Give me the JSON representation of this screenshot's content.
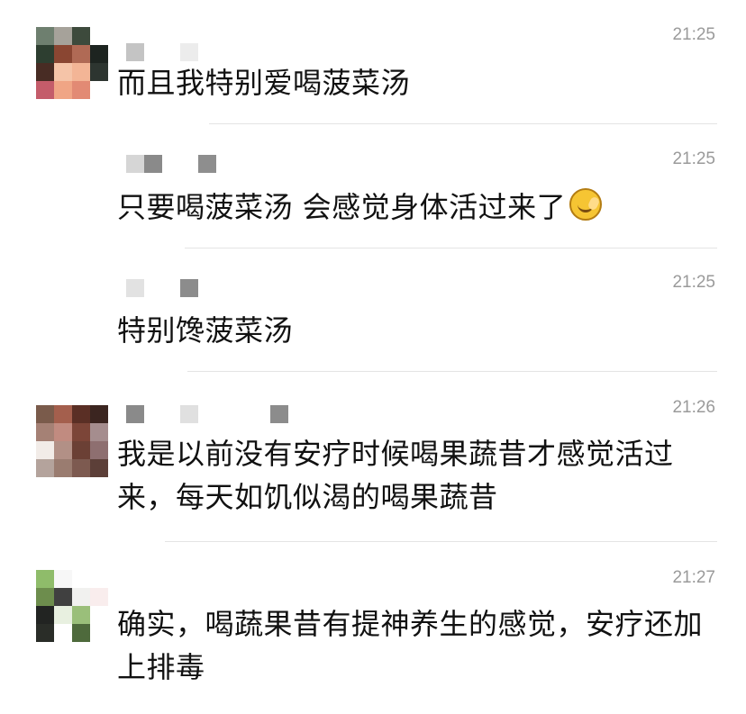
{
  "comments": [
    {
      "time": "21:25",
      "text": "而且我特别爱喝菠菜汤",
      "has_emoji": false
    },
    {
      "time": "21:25",
      "text": "只要喝菠菜汤 会感觉身体活过来了",
      "emoji": "face-exhaling-icon"
    },
    {
      "time": "21:25",
      "text": "特别馋菠菜汤"
    },
    {
      "time": "21:26",
      "text": "我是以前没有安疗时候喝果蔬昔才感觉活过来，每天如饥似渴的喝果蔬昔"
    },
    {
      "time": "21:27",
      "text": "确实，喝蔬果昔有提神养生的感觉，安疗还加上排毒"
    }
  ],
  "colors": {
    "background": "#ffffff",
    "text": "#111111",
    "timestamp": "#9a9a9a",
    "divider": "#e4e4e4"
  }
}
